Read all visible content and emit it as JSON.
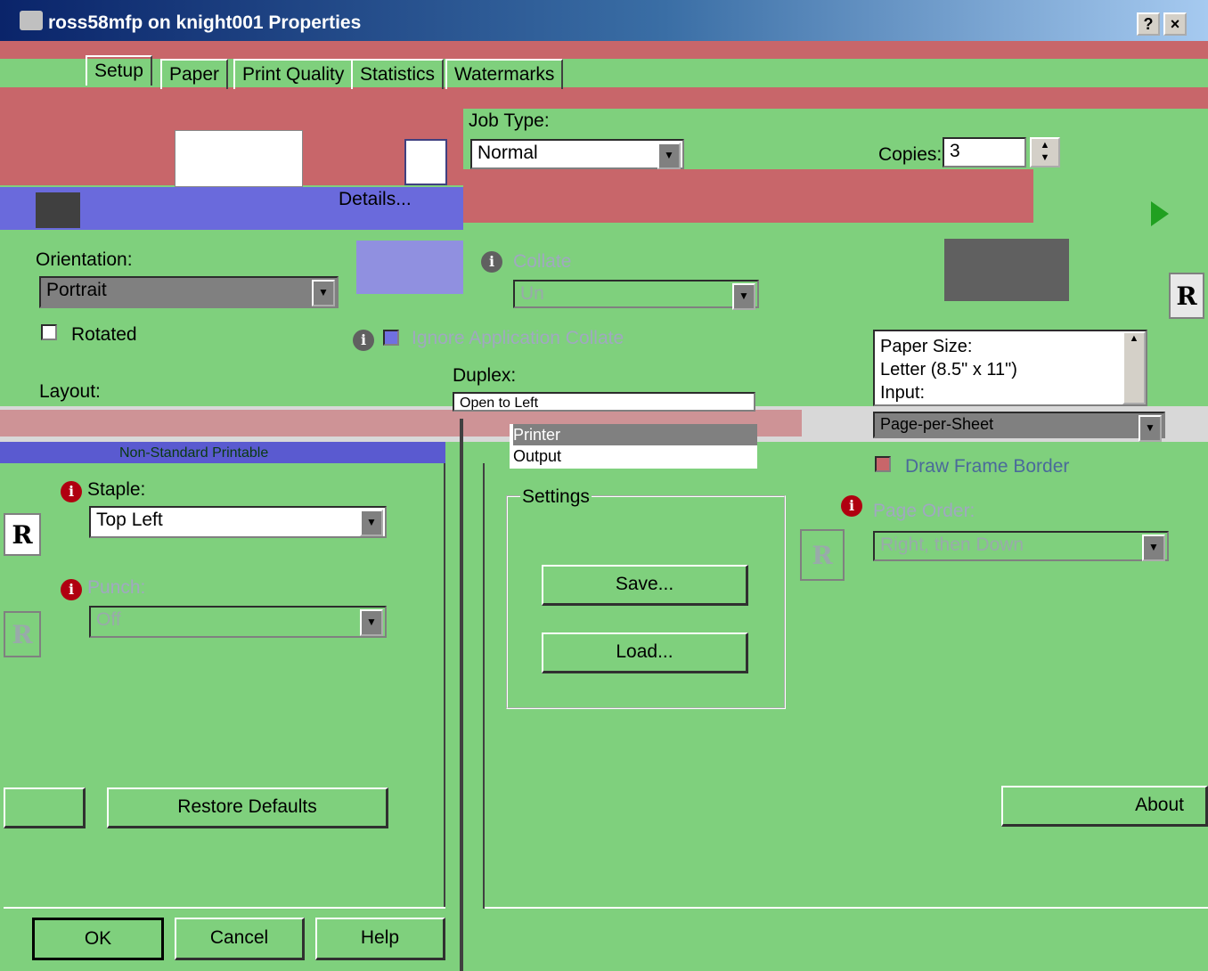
{
  "window": {
    "title": "ross58mfp on knight001 Properties",
    "help_btn": "?",
    "close_btn": "×"
  },
  "tabs": [
    {
      "label": "Setup"
    },
    {
      "label": "Paper"
    },
    {
      "label": "Print Quality"
    },
    {
      "label": "Statistics"
    },
    {
      "label": "Watermarks"
    }
  ],
  "job": {
    "type_label": "Job Type:",
    "type_value": "Normal",
    "copies_label": "Copies:",
    "copies_value": "3",
    "details_label": "Details..."
  },
  "orientation": {
    "label": "Orientation:",
    "value": "Portrait",
    "rotated_label": "Rotated"
  },
  "collate": {
    "label": "Collate",
    "value": "Un",
    "ignore_label": "Ignore Application Collate"
  },
  "duplex": {
    "label": "Duplex:",
    "value": "Open to Left"
  },
  "layout": {
    "label": "Layout:"
  },
  "paper_list": {
    "line1": "Paper Size:",
    "line2": "Letter (8.5\" x 11\")",
    "line3": "Input:"
  },
  "pages_per_sheet": {
    "value": "Page-per-Sheet",
    "frame_label": "Draw Frame Border"
  },
  "output": {
    "line1": "Printer",
    "line2": "Output"
  },
  "staple": {
    "label": "Staple:",
    "value": "Top Left"
  },
  "punch": {
    "label": "Punch:",
    "value": "Off"
  },
  "settings": {
    "group_label": "Settings",
    "save": "Save...",
    "load": "Load..."
  },
  "page_order": {
    "label": "Page Order:",
    "value": "Right, then Down"
  },
  "buttons": {
    "restore": "Restore Defaults",
    "about": "About",
    "ok": "OK",
    "cancel": "Cancel",
    "help": "Help"
  },
  "nonstandard_label": "Non-Standard Printable",
  "icon_letter": "R"
}
